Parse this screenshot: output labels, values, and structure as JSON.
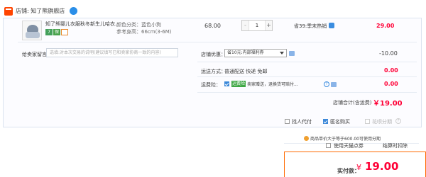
{
  "shop": {
    "icon": "shop-icon",
    "label": "店铺: 知了熊旗舰店",
    "chat_icon": "wangwang-chat-icon"
  },
  "item": {
    "title": "知了熊婴儿衣服秋冬新生儿哈衣...",
    "badges": [
      "7",
      "保",
      ""
    ],
    "sku_color": "颜色分类：蓝色小狗",
    "sku_size": "参考身高：66cm(3-6M)",
    "unit_price": "68.00",
    "quantity": "1",
    "minus": "-",
    "plus": "+",
    "promo": "省39:季末热销",
    "subtotal": "29.00"
  },
  "message": {
    "label": "给卖家留言：",
    "placeholder": "选填:对本次交易的说明(建议填写已和卖家协商一致的内容)"
  },
  "discount": {
    "label": "店铺优惠：",
    "selected": "省10元:内部福利券",
    "amount": "-10.00"
  },
  "shipping": {
    "label": "运送方式：",
    "value": "普通配送 快递 免邮",
    "amount": "0.00"
  },
  "insurance": {
    "label": "运费险：",
    "badge": "运费险",
    "text": "卖家赠送，退换货可赔付...",
    "amount": "0.00"
  },
  "shop_total": {
    "label": "店铺合计(含运费)",
    "value": "￥19.00"
  },
  "options": {
    "proxy_pay": "找人代付",
    "anonymous": "匿名购买",
    "installment": "花呗分期",
    "installment_note": "商品单价大于等于600.00可使用分期",
    "tmall_points": "使用天猫点券",
    "settlement": "结算时扣除"
  },
  "final": {
    "label": "实付款：",
    "currency": "¥",
    "value": "19.00"
  },
  "colors": {
    "accent": "#ff0036",
    "brand": "#ff4400",
    "link": "#3b8de0"
  }
}
